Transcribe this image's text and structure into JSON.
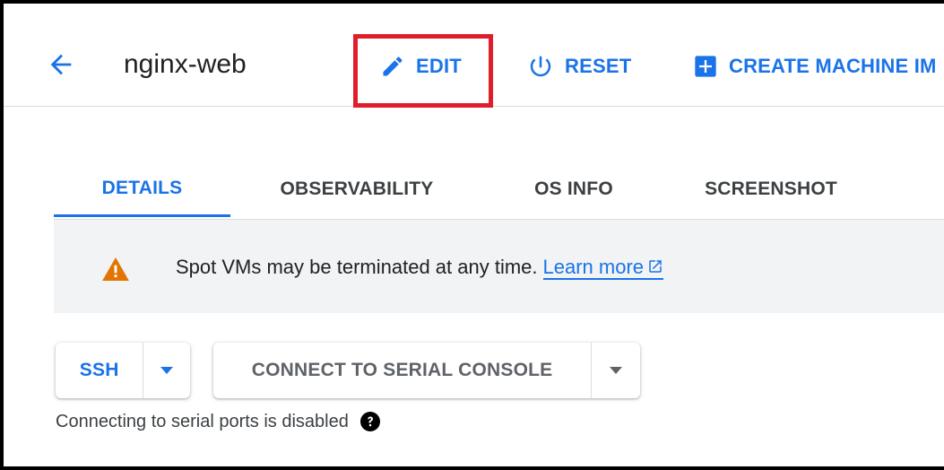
{
  "header": {
    "title": "nginx-web",
    "back_icon": "arrow-back-icon",
    "edit_label": "EDIT",
    "reset_label": "RESET",
    "create_label": "CREATE MACHINE IM"
  },
  "tabs": [
    {
      "label": "DETAILS",
      "active": true
    },
    {
      "label": "OBSERVABILITY",
      "active": false
    },
    {
      "label": "OS INFO",
      "active": false
    },
    {
      "label": "SCREENSHOT",
      "active": false
    }
  ],
  "banner": {
    "icon": "warning-icon",
    "text": "Spot VMs may be terminated at any time.",
    "link": "Learn more"
  },
  "connect": {
    "ssh_label": "SSH",
    "serial_label": "CONNECT TO SERIAL CONSOLE",
    "serial_note": "Connecting to serial ports is disabled"
  },
  "colors": {
    "accent": "#1a73e8",
    "highlight": "#e01e2b",
    "warning": "#e37400",
    "banner_bg": "#f1f3f4"
  }
}
